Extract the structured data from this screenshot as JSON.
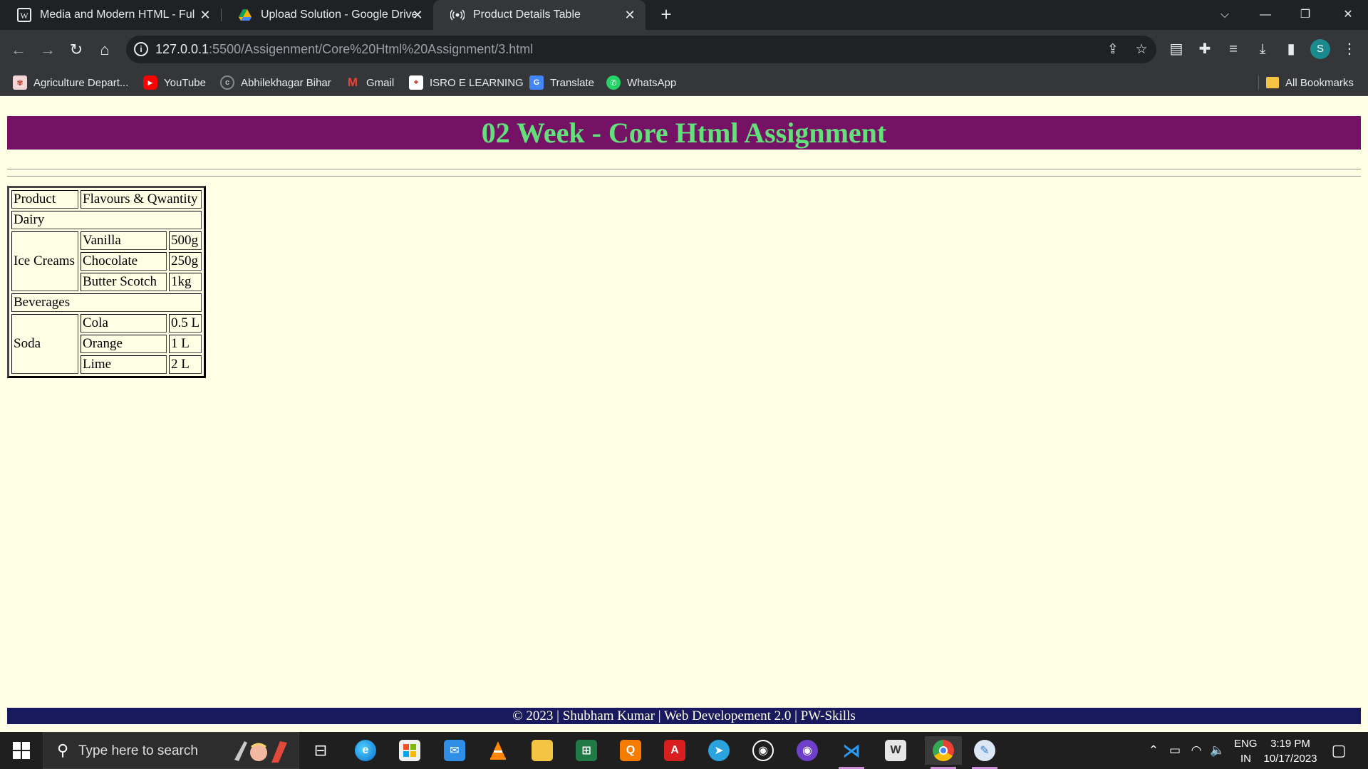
{
  "browser": {
    "tabs": [
      {
        "title": "Media and Modern HTML - Full",
        "active": false
      },
      {
        "title": "Upload Solution - Google Drive",
        "active": false
      },
      {
        "title": "Product Details Table",
        "active": true
      }
    ],
    "url_host": "127.0.0.1",
    "url_path": ":5500/Assigenment/Core%20Html%20Assignment/3.html",
    "profile_initial": "S",
    "bookmarks": [
      {
        "label": "Agriculture Depart...",
        "icon": "agriculture-icon"
      },
      {
        "label": "YouTube",
        "icon": "youtube-icon"
      },
      {
        "label": "Abhilekhagar Bihar",
        "icon": "abhilekhagar-icon"
      },
      {
        "label": "Gmail",
        "icon": "gmail-icon"
      },
      {
        "label": "ISRO E LEARNING",
        "icon": "isro-icon"
      },
      {
        "label": "Translate",
        "icon": "translate-icon"
      },
      {
        "label": "WhatsApp",
        "icon": "whatsapp-icon"
      }
    ],
    "all_bookmarks": "All Bookmarks"
  },
  "page": {
    "heading": "02 Week - Core Html Assignment",
    "table": {
      "header": {
        "product": "Product",
        "flavours": "Flavours & Qwantity"
      },
      "sections": [
        {
          "category": "Dairy",
          "product": "Ice Creams",
          "items": [
            {
              "flavour": "Vanilla",
              "qty": "500g"
            },
            {
              "flavour": "Chocolate",
              "qty": "250g"
            },
            {
              "flavour": "Butter Scotch",
              "qty": "1kg"
            }
          ]
        },
        {
          "category": "Beverages",
          "product": "Soda",
          "items": [
            {
              "flavour": "Cola",
              "qty": "0.5 L"
            },
            {
              "flavour": "Orange",
              "qty": "1 L"
            },
            {
              "flavour": "Lime",
              "qty": "2 L"
            }
          ]
        }
      ]
    },
    "footer": "© 2023 | Shubham Kumar | Web Developement 2.0 | PW-Skills"
  },
  "taskbar": {
    "search_placeholder": "Type here to search",
    "language": "ENG",
    "region": "IN",
    "time": "3:19 PM",
    "date": "10/17/2023"
  },
  "colors": {
    "page_bg": "#ffffe6",
    "banner_bg": "#751266",
    "banner_text": "#64e07a",
    "footer_bg": "#191a5e"
  }
}
